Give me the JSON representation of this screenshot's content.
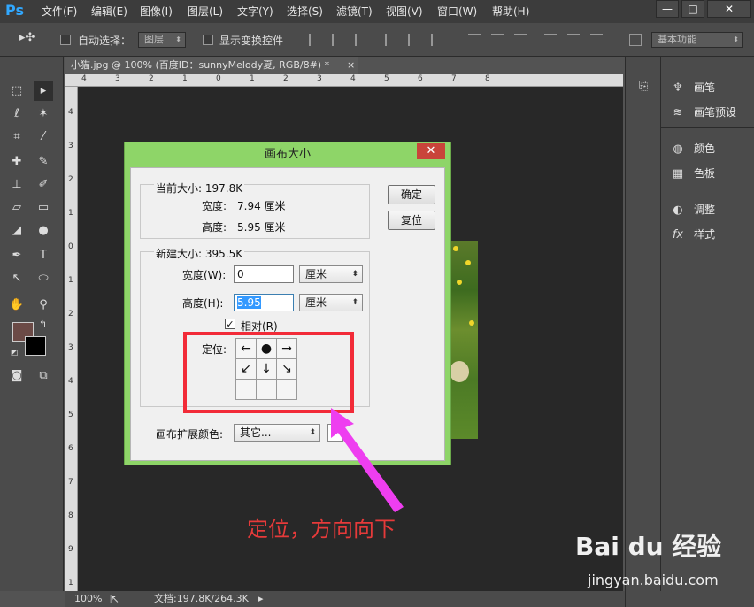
{
  "app": {
    "logo": "Ps"
  },
  "menubar": {
    "items": [
      "文件(F)",
      "编辑(E)",
      "图像(I)",
      "图层(L)",
      "文字(Y)",
      "选择(S)",
      "滤镜(T)",
      "视图(V)",
      "窗口(W)",
      "帮助(H)"
    ],
    "window_controls": [
      "—",
      "□",
      "✕"
    ]
  },
  "options_bar": {
    "auto_select_label": "自动选择：",
    "auto_select_value": "图层",
    "show_transform_label": "显示变换控件",
    "workspace_value": "基本功能"
  },
  "document": {
    "tab_title": "小猫.jpg @ 100% (百度ID：sunnyMelody夏, RGB/8#) *",
    "tab_close": "×",
    "ruler_top": [
      "4",
      "3",
      "2",
      "1",
      "0",
      "1",
      "2",
      "3",
      "4",
      "5",
      "6",
      "7",
      "8"
    ],
    "ruler_left": [
      "4",
      "3",
      "2",
      "1",
      "0",
      "1",
      "2",
      "3",
      "4",
      "5",
      "6",
      "7",
      "8",
      "9",
      "1"
    ]
  },
  "status_bar": {
    "zoom": "100%",
    "doc_info": "文档:197.8K/264.3K"
  },
  "right_panel": {
    "items": [
      {
        "icon": "brush-icon",
        "label": "画笔"
      },
      {
        "icon": "brush-presets-icon",
        "label": "画笔预设"
      },
      {
        "icon": "palette-icon",
        "label": "颜色"
      },
      {
        "icon": "swatches-icon",
        "label": "色板"
      },
      {
        "icon": "adjustments-icon",
        "label": "调整"
      },
      {
        "icon": "styles-icon",
        "label": "样式"
      }
    ]
  },
  "dialog": {
    "title": "画布大小",
    "close": "✕",
    "current_size_label": "当前大小: 197.8K",
    "current_width_label": "宽度:",
    "current_width_value": "7.94 厘米",
    "current_height_label": "高度:",
    "current_height_value": "5.95 厘米",
    "new_size_label": "新建大小: 395.5K",
    "width_label": "宽度(W):",
    "width_value": "0",
    "width_unit": "厘米",
    "height_label": "高度(H):",
    "height_value": "5.95",
    "height_unit": "厘米",
    "relative_label": "相对(R)",
    "anchor_label": "定位:",
    "anchor_cells": [
      "←",
      "●",
      "→",
      "↙",
      "↓",
      "↘",
      "",
      "",
      ""
    ],
    "extension_color_label": "画布扩展颜色:",
    "extension_color_value": "其它...",
    "ok_button": "确定",
    "reset_button": "复位"
  },
  "annotation": {
    "caption": "定位，方向向下",
    "box_color": "#f22b38",
    "arrow_color": "#ee3ef0"
  },
  "watermark": {
    "brand": "Bai du 经验",
    "url": "jingyan.baidu.com"
  },
  "colors": {
    "foreground": "#6b4a46",
    "background": "#000000",
    "dialog_frame": "#8ed568"
  }
}
